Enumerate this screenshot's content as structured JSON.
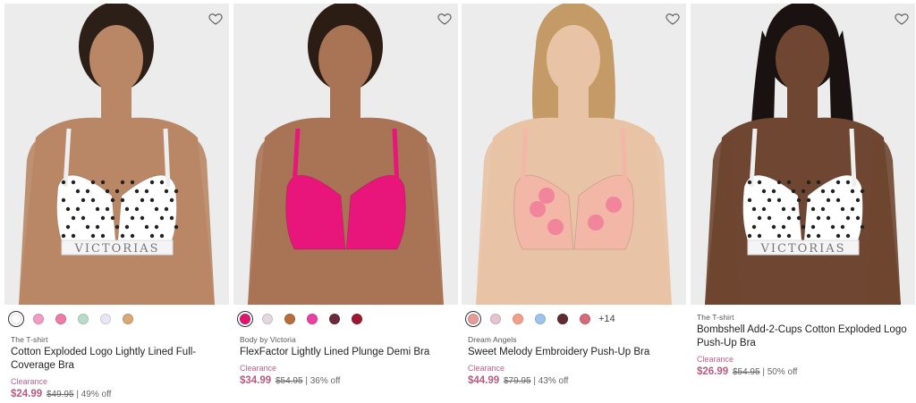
{
  "products": [
    {
      "brand": "The T-shirt",
      "name": "Cotton Exploded Logo Lightly Lined Full-Coverage Bra",
      "badge": "Clearance",
      "price": "$24.99",
      "original_price": "$49.95",
      "discount": "| 49% off",
      "more_colors": "",
      "swatches": [
        "#ffffff",
        "#f29bc6",
        "#ee7aa8",
        "#b9dcc8",
        "#e8e6f6",
        "#d9a877"
      ],
      "bra_color": "#ffffff",
      "band_text": "VICTORIAS",
      "skin": "#b98766",
      "hair": "#2b1f18"
    },
    {
      "brand": "Body by Victoria",
      "name": "FlexFactor Lightly Lined Plunge Demi Bra",
      "badge": "Clearance",
      "price": "$34.99",
      "original_price": "$54.95",
      "discount": "| 36% off",
      "more_colors": "",
      "swatches": [
        "#e0166e",
        "#e4d8df",
        "#b66d3c",
        "#ec3fa4",
        "#6a2c3a",
        "#9b1830"
      ],
      "bra_color": "#e8157a",
      "band_text": "",
      "skin": "#a97455",
      "hair": "#2c1d14"
    },
    {
      "brand": "Dream Angels",
      "name": "Sweet Melody Embroidery Push-Up Bra",
      "badge": "Clearance",
      "price": "$44.99",
      "original_price": "$79.95",
      "discount": "| 43% off",
      "more_colors": "+14",
      "swatches": [
        "#e79a9a",
        "#e6c3d0",
        "#f3a08a",
        "#9ec4ee",
        "#5e2a33",
        "#d66a78"
      ],
      "bra_color": "#f2b7a6",
      "band_text": "",
      "skin": "#e9c3a6",
      "hair": "#c49a66"
    },
    {
      "brand": "The T-shirt",
      "name": "Bombshell Add-2-Cups Cotton Exploded Logo Push-Up Bra",
      "badge": "Clearance",
      "price": "$26.99",
      "original_price": "$54.95",
      "discount": "| 50% off",
      "more_colors": "",
      "swatches": [],
      "bra_color": "#ffffff",
      "band_text": "VICTORIAS",
      "skin": "#6e4631",
      "hair": "#1a1210"
    }
  ],
  "icons": {
    "favorite": "heart-outline-icon"
  },
  "colors": {
    "clearance": "#c0608c",
    "sale_price": "#b85a84"
  }
}
